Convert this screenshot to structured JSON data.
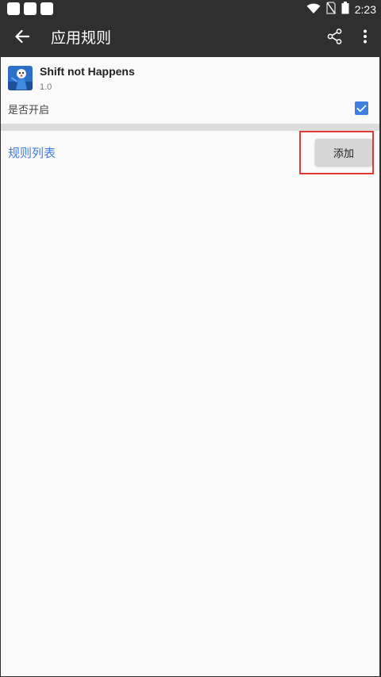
{
  "status_bar": {
    "time": "2:23",
    "notification_icons": [
      "notification-icon",
      "notification-icon",
      "notification-icon"
    ],
    "system_icons": [
      "wifi-icon",
      "no-sim-icon",
      "battery-icon"
    ]
  },
  "app_bar": {
    "title": "应用规则",
    "back_icon": "arrow-left-icon",
    "share_icon": "share-icon",
    "more_icon": "more-vert-icon"
  },
  "app_info": {
    "name": "Shift not Happens",
    "version": "1.0"
  },
  "enable": {
    "label": "是否开启",
    "checked": true
  },
  "rules": {
    "list_label": "规则列表",
    "add_button": "添加"
  },
  "colors": {
    "bar": "#2f2f2f",
    "background": "#fafafa",
    "accent": "#3f7fe0",
    "highlight": "#e53935",
    "button": "#d6d6d6"
  }
}
